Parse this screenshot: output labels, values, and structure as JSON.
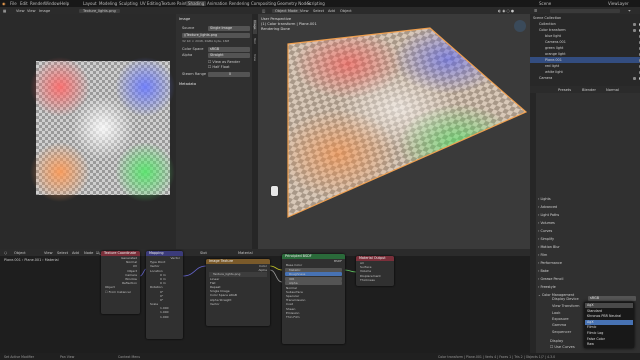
{
  "menu": [
    "File",
    "Edit",
    "Render",
    "Window",
    "Help"
  ],
  "workspaces": [
    "Layout",
    "Modeling",
    "Sculpting",
    "UV Editing",
    "Texture Paint",
    "Shading",
    "Animation",
    "Rendering",
    "Compositing",
    "Geometry Nodes",
    "Scripting"
  ],
  "active_workspace": "Shading",
  "scene": "Scene",
  "view_layer": "ViewLayer",
  "image_editor": {
    "menu": [
      "View",
      "View",
      "Image"
    ],
    "image_name": "Texture_lights.png",
    "sidebar_tabs": [
      "Image",
      "Tool",
      "View"
    ],
    "panel_title": "Image",
    "source_label": "Source",
    "source_value": "Single Image",
    "file": "//Texture_lights.png",
    "info": "32 bit × 2048, RGBA byte, 16M",
    "color_space_label": "Color Space",
    "color_space_value": "sRGB",
    "alpha_label": "Alpha",
    "alpha_value": "Straight",
    "view_as_render": "View as Render",
    "use_half": "Half Float",
    "steam_range_label": "Steam Range",
    "steam_range_value": "0",
    "metadata": "Metadata"
  },
  "viewport": {
    "menu": [
      "Object Mode",
      "View",
      "Select",
      "Add",
      "Object"
    ],
    "view": "User Perspective",
    "collection": "(1) Color transform | Plane.001",
    "render_state": "Rendering Done"
  },
  "outliner": {
    "title": "Scene Collection",
    "search_placeholder": "",
    "items": [
      {
        "name": "Scene Collection",
        "indent": 0
      },
      {
        "name": "Collection",
        "indent": 1
      },
      {
        "name": "Color transform",
        "indent": 1
      },
      {
        "name": "blue light",
        "indent": 2
      },
      {
        "name": "Camera.001",
        "indent": 2
      },
      {
        "name": "green light",
        "indent": 2
      },
      {
        "name": "orange light",
        "indent": 2
      },
      {
        "name": "Plane.001",
        "indent": 2
      },
      {
        "name": "red light",
        "indent": 2
      },
      {
        "name": "white light",
        "indent": 2
      },
      {
        "name": "Camera",
        "indent": 1
      }
    ]
  },
  "properties": {
    "tabs": [
      "Presets",
      "Blender",
      "Normal"
    ],
    "sections": [
      "Lights",
      "Advanced",
      "Light Paths",
      "Volumes",
      "Curves",
      "Simplify",
      "Motion Blur",
      "Film",
      "Performance",
      "Bake",
      "Grease Pencil",
      "Freestyle",
      "Color Management"
    ],
    "display_device_label": "Display Device",
    "display_device_value": "sRGB",
    "view_transform_label": "View Transform",
    "look_label": "Look",
    "exposure_label": "Exposure",
    "gamma_label": "Gamma",
    "sequencer_label": "Sequencer",
    "display_label": "Display",
    "use_curves_label": "Use Curves",
    "dropdown_options": [
      "AgX",
      "Standard",
      "Khronos PBR Neutral",
      "AgX",
      "Filmic",
      "Filmic Log",
      "False Color",
      "Raw"
    ],
    "dropdown_selected": 3
  },
  "node_editor": {
    "menu": [
      "Object",
      "View",
      "Select",
      "Add",
      "Node",
      "Use Nodes"
    ],
    "slot": "Slot",
    "material": "Material",
    "breadcrumb": [
      "Plane.001",
      "Plane.001",
      "Material"
    ],
    "nodes": {
      "texcoord": {
        "title": "Texture Coordinate",
        "outputs": [
          "Generated",
          "Normal",
          "UV",
          "Object",
          "Camera",
          "Window",
          "Reflection"
        ],
        "object_label": "Object",
        "from_instancer": "From Instancer"
      },
      "mapping": {
        "title": "Mapping",
        "output": "Vector",
        "type_label": "Type",
        "type_value": "Point",
        "vector": "Vector",
        "location": "Location",
        "rotation": "Rotation",
        "scale": "Scale",
        "loc_vals": [
          "0 m",
          "0 m",
          "0 m"
        ],
        "rot_vals": [
          "0°",
          "0°",
          "0°"
        ],
        "scale_vals": [
          "1.000",
          "1.000",
          "1.000"
        ]
      },
      "image_tex": {
        "title": "Image Texture",
        "outputs": [
          "Color",
          "Alpha"
        ],
        "image": "Texture_lights.png",
        "interp": "Linear",
        "proj": "Flat",
        "ext": "Repeat",
        "src": "Single Image",
        "cs_label": "Color Space",
        "cs_value": "sRGB",
        "alpha_label": "Alpha",
        "alpha_value": "Straight",
        "vector": "Vector"
      },
      "bsdf": {
        "title": "Principled BSDF",
        "output": "BSDF",
        "rows": [
          "Base Color",
          "Metallic",
          "Roughness",
          "IOR",
          "Alpha",
          "Normal",
          "Subsurface",
          "Specular",
          "Transmission",
          "Coat",
          "Sheen",
          "Emission",
          "Thin Film"
        ]
      },
      "output": {
        "title": "Material Output",
        "target": "All",
        "inputs": [
          "Surface",
          "Volume",
          "Displacement",
          "Thickness"
        ]
      }
    }
  },
  "status_bar": {
    "left": [
      "Set Active Modifier",
      "Pan View",
      "Context Menu"
    ],
    "right": "Color transform | Plane.001 | Verts 4 | Faces 1 | Tris 2 | Objects 1/7 | 4.3.0"
  },
  "colors": {
    "accent": "#4772b3",
    "selected_row": "#334d80",
    "header_orange": "#f0a050"
  }
}
